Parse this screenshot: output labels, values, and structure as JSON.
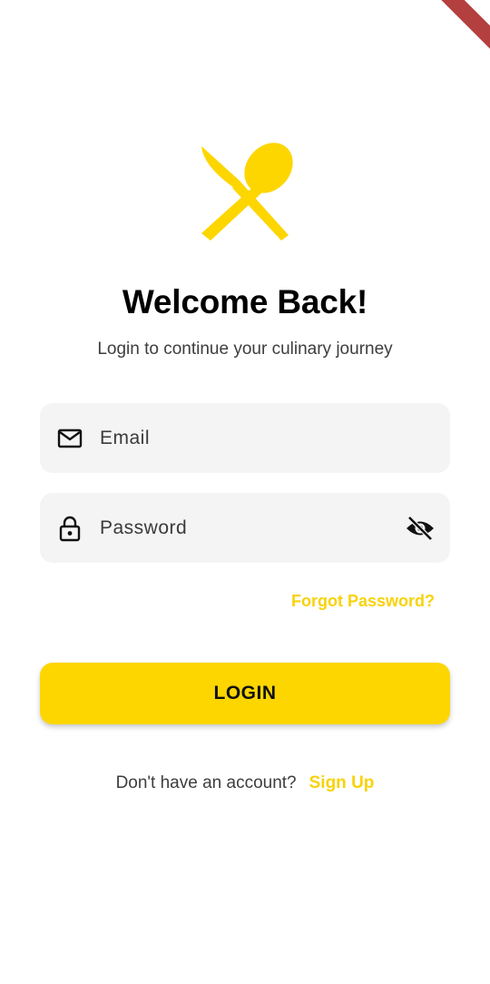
{
  "header": {
    "logo_icon": "fork-spoon-icon",
    "title": "Welcome Back!",
    "subtitle": "Login to continue your culinary journey"
  },
  "form": {
    "email": {
      "icon": "mail-icon",
      "placeholder": "Email",
      "value": ""
    },
    "password": {
      "icon": "lock-icon",
      "placeholder": "Password",
      "value": "",
      "toggle_icon": "eye-off-icon"
    },
    "forgot_label": "Forgot Password?",
    "login_label": "LOGIN"
  },
  "footer": {
    "prompt": "Don't have an account?",
    "signup_label": "Sign Up"
  },
  "colors": {
    "accent": "#fdd600",
    "link": "#f9d20a",
    "field_bg": "#f4f4f4",
    "debug_banner": "#b3403f"
  }
}
